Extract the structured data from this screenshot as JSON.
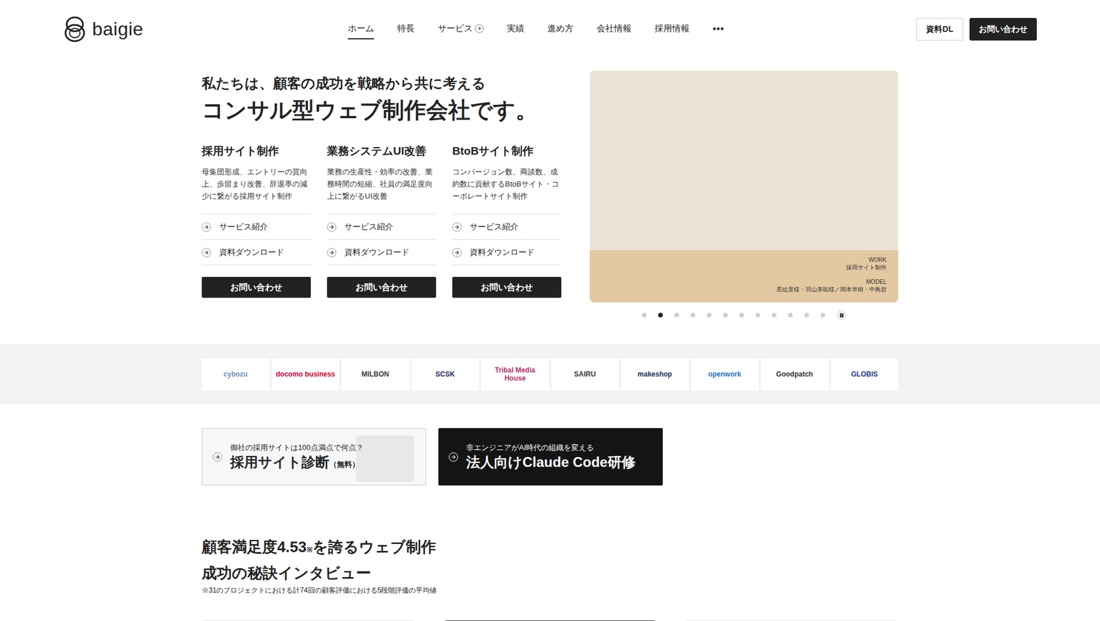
{
  "header": {
    "logo": "baigie",
    "nav": [
      {
        "label": "ホーム",
        "selected": true,
        "kind": "link"
      },
      {
        "label": "特長",
        "selected": false,
        "kind": "link"
      },
      {
        "label": "サービス",
        "selected": false,
        "kind": "expandable"
      },
      {
        "label": "実績",
        "selected": false,
        "kind": "link"
      },
      {
        "label": "進め方",
        "selected": false,
        "kind": "link"
      },
      {
        "label": "会社情報",
        "selected": false,
        "kind": "link"
      },
      {
        "label": "採用情報",
        "selected": false,
        "kind": "link"
      }
    ],
    "more": "•••",
    "buttons": [
      {
        "label": "資料DL",
        "kind": "outline"
      },
      {
        "label": "お問い合わせ",
        "kind": "solid"
      }
    ]
  },
  "hero": {
    "tagline": "私たちは、顧客の成功を戦略から共に考える",
    "title": "コンサル型ウェブ制作会社です。",
    "services": [
      {
        "title": "採用サイト制作",
        "description": "母集団形成、エントリーの質向上、歩留まり改善、辞退率の減少に繋がる採用サイト制作",
        "links": [
          "サービス紹介",
          "資料ダウンロード"
        ],
        "button": "お問い合わせ"
      },
      {
        "title": "業務システムUI改善",
        "description": "業務の生産性・効率の改善、業務時間の短縮、社員の満足度向上に繋がるUI改善",
        "links": [
          "サービス紹介",
          "資料ダウンロード"
        ],
        "button": "お問い合わせ"
      },
      {
        "title": "BtoBサイト制作",
        "description": "コンバージョン数、商談数、成約数に貢献するBtoBサイト・コーポレートサイト制作",
        "links": [
          "サービス紹介",
          "資料ダウンロード"
        ],
        "button": "お問い合わせ"
      }
    ]
  },
  "slider": {
    "work_label": "WORK",
    "work": "採用サイト制作",
    "model_label": "MODEL",
    "model": "星絵里様・羽山美聡様／岡本早樹・中島碧",
    "playing": true,
    "dots": [
      {
        "selected": false
      },
      {
        "selected": true
      },
      {
        "selected": false
      },
      {
        "selected": false
      },
      {
        "selected": false
      },
      {
        "selected": false
      },
      {
        "selected": false
      },
      {
        "selected": false
      },
      {
        "selected": false
      },
      {
        "selected": false
      },
      {
        "selected": false
      },
      {
        "selected": false
      }
    ]
  },
  "clients": [
    {
      "name": "cybozu",
      "color": "#6a8fae"
    },
    {
      "name": "docomo business",
      "color": "#cc0033"
    },
    {
      "name": "MILBON",
      "color": "#3a3a3a"
    },
    {
      "name": "SCSK",
      "color": "#1d2a6b"
    },
    {
      "name": "Tribal Media House",
      "color": "#b0306b"
    },
    {
      "name": "SAIRU",
      "color": "#333333"
    },
    {
      "name": "makeshop",
      "color": "#1a2e5a"
    },
    {
      "name": "openwork",
      "color": "#1a73c8"
    },
    {
      "name": "Goodpatch",
      "color": "#333333"
    },
    {
      "name": "GLOBIS",
      "color": "#1f3c88"
    }
  ],
  "banners": [
    {
      "kind": "light",
      "eyebrow": "御社の採用サイトは100点満点で何点？",
      "title": "採用サイト診断",
      "badge": "（無料）"
    },
    {
      "kind": "dark",
      "eyebrow": "非エンジニアがAI時代の組織を変える",
      "title": "法人向けClaude Code研修",
      "badge": ""
    }
  ],
  "interview": {
    "title_before": "顧客満足度4.53",
    "mark": "※",
    "title_after": "を誇るウェブ制作",
    "title_line2": "成功の秘訣インタビュー",
    "note": "※31のプロジェクトにおける計74回の顧客評価における5段階評価の平均値",
    "cards": [
      {
        "color": "#e6e3da"
      },
      {
        "color": "#3d4a3b"
      },
      {
        "color": "#ebe9e3"
      }
    ]
  }
}
